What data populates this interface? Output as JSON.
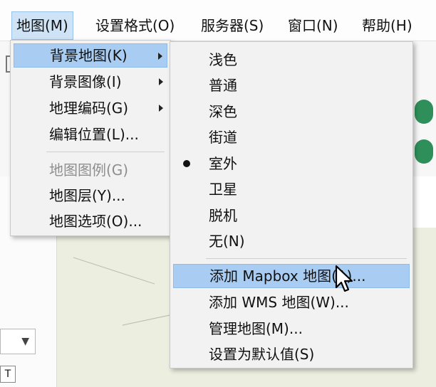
{
  "menubar": {
    "items": [
      {
        "label": "地图(M)"
      },
      {
        "label": "设置格式(O)"
      },
      {
        "label": "服务器(S)"
      },
      {
        "label": "窗口(N)"
      },
      {
        "label": "帮助(H)"
      }
    ]
  },
  "map_menu": {
    "items": [
      {
        "label": "背景地图(K)"
      },
      {
        "label": "背景图像(I)"
      },
      {
        "label": "地理编码(G)"
      },
      {
        "label": "编辑位置(L)..."
      },
      {
        "label": "地图图例(G)"
      },
      {
        "label": "地图层(Y)..."
      },
      {
        "label": "地图选项(O)..."
      }
    ]
  },
  "background_maps_submenu": {
    "styles": [
      {
        "label": "浅色"
      },
      {
        "label": "普通"
      },
      {
        "label": "深色"
      },
      {
        "label": "街道"
      },
      {
        "label": "室外"
      },
      {
        "label": "卫星"
      },
      {
        "label": "脱机"
      },
      {
        "label": "无(N)"
      }
    ],
    "actions": [
      {
        "label": "添加 Mapbox 地图(A)..."
      },
      {
        "label": "添加 WMS 地图(W)..."
      },
      {
        "label": "管理地图(M)..."
      },
      {
        "label": "设置为默认值(S)"
      }
    ]
  },
  "background": {
    "tbox_label": "T"
  },
  "colors": {
    "highlight": "#a9cdf2",
    "menu_bg": "#f2f2f2",
    "menubar_active": "#cfe3f7",
    "map_bg": "#eceee0",
    "status_green": "#2f8f5a"
  }
}
